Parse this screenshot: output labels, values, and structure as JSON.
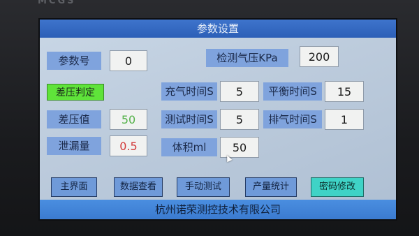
{
  "bezel": {
    "brand": "MCGS"
  },
  "screen": {
    "title": "参数设置",
    "fields": {
      "param_no": {
        "label": "参数号",
        "value": "0"
      },
      "diff_judge": {
        "label": "差压判定"
      },
      "diff_value": {
        "label": "差压值",
        "value": "50"
      },
      "leak_amount": {
        "label": "泄漏量",
        "value": "0.5"
      },
      "test_pressure": {
        "label": "检测气压KPa",
        "value": "200"
      },
      "fill_time": {
        "label": "充气时间S",
        "value": "5"
      },
      "balance_time": {
        "label": "平衡时间S",
        "value": "15"
      },
      "test_time": {
        "label": "测试时间S",
        "value": "5"
      },
      "exhaust_time": {
        "label": "排气时间S",
        "value": "1"
      },
      "volume": {
        "label": "体积ml",
        "value": "50"
      }
    },
    "nav": {
      "main": "主界面",
      "data_view": "数据查看",
      "manual_test": "手动测试",
      "production_stats": "产量统计",
      "password_change": "密码修改"
    },
    "footer": "杭州诺荣测控技术有限公司"
  },
  "colors": {
    "titlebar": "#2f64bb",
    "label_bg": "#7fa3dd",
    "green_button": "#5fe33a",
    "teal_button": "#3fd3c6",
    "diff_value_text": "#55b24a",
    "leak_value_text": "#d23a3a"
  }
}
